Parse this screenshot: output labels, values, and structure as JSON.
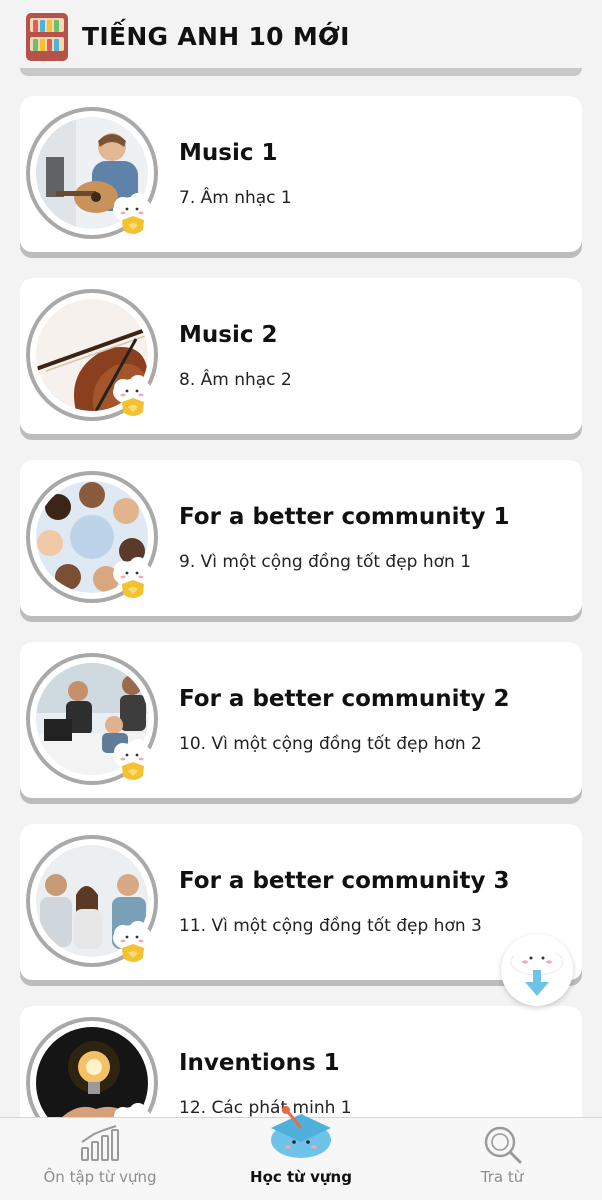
{
  "header": {
    "title": "TIẾNG ANH 10 MỚI",
    "icon": "bookshelf-icon",
    "dropdown_icon": "chevron-down-icon"
  },
  "lessons": [
    {
      "title": "Music 1",
      "subtitle": "7. Âm nhạc 1",
      "image": "guitar-player-photo"
    },
    {
      "title": "Music 2",
      "subtitle": "8. Âm nhạc 2",
      "image": "violin-photo"
    },
    {
      "title": "For a better community 1",
      "subtitle": "9. Vì một cộng đồng tốt đẹp hơn 1",
      "image": "group-circle-photo"
    },
    {
      "title": "For a better community 2",
      "subtitle": "10. Vì một cộng đồng tốt đẹp hơn 2",
      "image": "meeting-photo"
    },
    {
      "title": "For a better community 3",
      "subtitle": "11. Vì một cộng đồng tốt đẹp hơn 3",
      "image": "team-discussion-photo"
    },
    {
      "title": "Inventions 1",
      "subtitle": "12. Các phát minh 1",
      "image": "lightbulb-photo"
    }
  ],
  "bottom_nav": {
    "items": [
      {
        "label": "Ôn tập từ vựng",
        "icon": "bar-chart-icon"
      },
      {
        "label": "Học từ vựng",
        "icon": "graduation-cap-icon",
        "active": true
      },
      {
        "label": "Tra từ",
        "icon": "search-icon"
      }
    ]
  },
  "colors": {
    "accent": "#6fc3e8",
    "badge_gold": "#f2c230",
    "background": "#f3f3f3"
  }
}
